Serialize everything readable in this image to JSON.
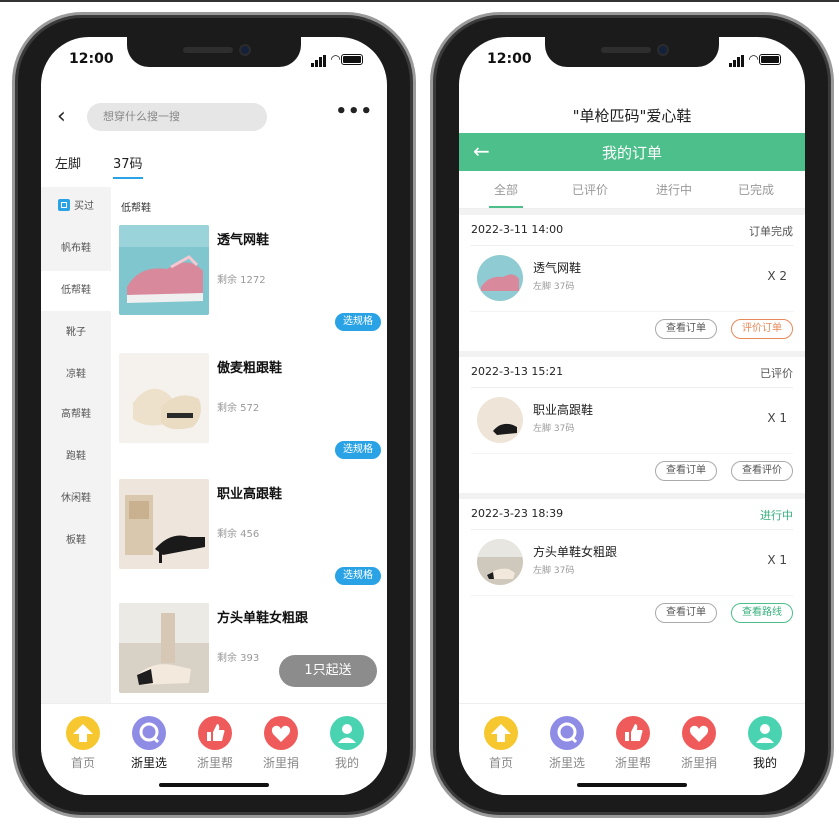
{
  "status": {
    "time": "12:00"
  },
  "left": {
    "search_placeholder": "想穿什么搜一搜",
    "more": "•••",
    "filter_foot": "左脚",
    "filter_size": "37码",
    "categories": [
      "买过",
      "帆布鞋",
      "低帮鞋",
      "靴子",
      "凉鞋",
      "高帮鞋",
      "跑鞋",
      "休闲鞋",
      "板鞋"
    ],
    "section_header": "低帮鞋",
    "products": [
      {
        "name": "透气网鞋",
        "stock": "剩余 1272",
        "button": "选规格"
      },
      {
        "name": "傲麦粗跟鞋",
        "stock": "剩余 572",
        "button": "选规格"
      },
      {
        "name": "职业高跟鞋",
        "stock": "剩余 456",
        "button": "选规格"
      },
      {
        "name": "方头单鞋女粗跟",
        "stock": "剩余 393",
        "button": "选规格"
      }
    ],
    "min_order": "1只起送"
  },
  "right": {
    "app_title": "\"单枪匹码\"爱心鞋",
    "page_title": "我的订单",
    "back": "←",
    "tabs": [
      "全部",
      "已评价",
      "进行中",
      "已完成"
    ],
    "orders": [
      {
        "date": "2022-3-11 14:00",
        "status": "订单完成",
        "name": "透气网鞋",
        "spec": "左脚 37码",
        "qty": "X 2",
        "btn1": "查看订单",
        "btn2": "评价订单"
      },
      {
        "date": "2022-3-13 15:21",
        "status": "已评价",
        "name": "职业高跟鞋",
        "spec": "左脚 37码",
        "qty": "X 1",
        "btn1": "查看订单",
        "btn2": "查看评价"
      },
      {
        "date": "2022-3-23 18:39",
        "status": "进行中",
        "name": "方头单鞋女粗跟",
        "spec": "左脚 37码",
        "qty": "X 1",
        "btn1": "查看订单",
        "btn2": "查看路线"
      }
    ]
  },
  "tabbar": [
    "首页",
    "浙里选",
    "浙里帮",
    "浙里捐",
    "我的"
  ],
  "colors": {
    "accent_blue": "#2aa3e6",
    "accent_green": "#4cbf8a",
    "orange": "#e8895a"
  }
}
